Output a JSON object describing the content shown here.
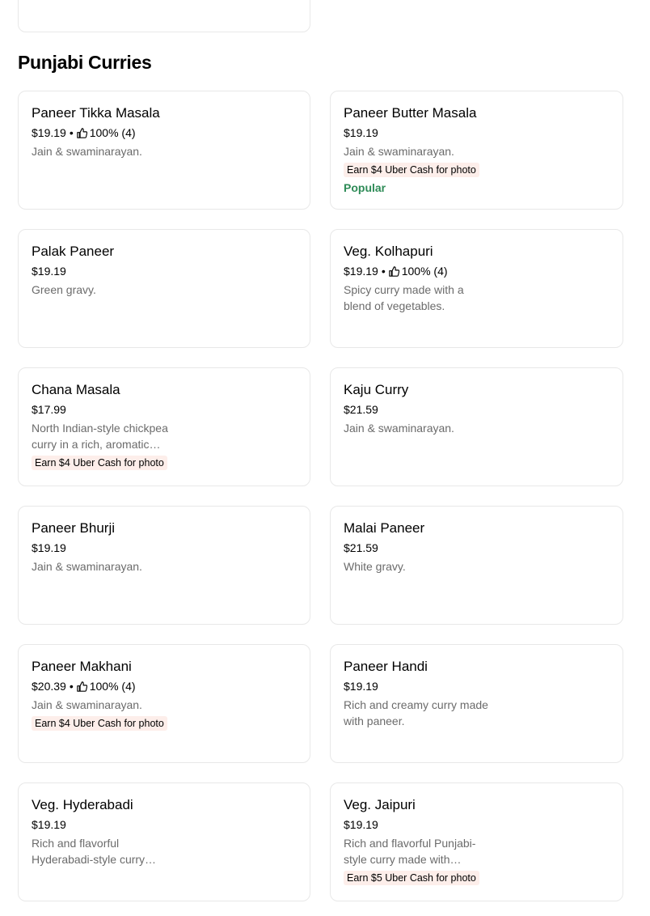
{
  "section": {
    "title": "Punjabi Curries"
  },
  "colors": {
    "popular": "#2e8b57",
    "promo_bg": "#fdeeea",
    "description": "#6b6b6b",
    "card_border": "#e8e8e8"
  },
  "items": [
    {
      "name": "Paneer Tikka Masala",
      "price": "$19.19",
      "rating": "100% (4)",
      "description": "Jain & swaminarayan.",
      "promo": "",
      "badge": ""
    },
    {
      "name": "Paneer Butter Masala",
      "price": "$19.19",
      "rating": "",
      "description": "Jain & swaminarayan.",
      "promo": "Earn $4 Uber Cash for photo",
      "badge": "Popular"
    },
    {
      "name": "Palak Paneer",
      "price": "$19.19",
      "rating": "",
      "description": "Green gravy.",
      "promo": "",
      "badge": ""
    },
    {
      "name": "Veg. Kolhapuri",
      "price": "$19.19",
      "rating": "100% (4)",
      "description": "Spicy curry made with a blend of vegetables.",
      "promo": "",
      "badge": ""
    },
    {
      "name": "Chana Masala",
      "price": "$17.99",
      "rating": "",
      "description": "North Indian-style chickpea curry in a rich, aromatic…",
      "promo": "Earn $4 Uber Cash for photo",
      "badge": ""
    },
    {
      "name": "Kaju Curry",
      "price": "$21.59",
      "rating": "",
      "description": "Jain & swaminarayan.",
      "promo": "",
      "badge": ""
    },
    {
      "name": "Paneer Bhurji",
      "price": "$19.19",
      "rating": "",
      "description": "Jain & swaminarayan.",
      "promo": "",
      "badge": ""
    },
    {
      "name": "Malai Paneer",
      "price": "$21.59",
      "rating": "",
      "description": "White gravy.",
      "promo": "",
      "badge": ""
    },
    {
      "name": "Paneer Makhani",
      "price": "$20.39",
      "rating": "100% (4)",
      "description": "Jain & swaminarayan.",
      "promo": "Earn $4 Uber Cash for photo",
      "badge": ""
    },
    {
      "name": "Paneer Handi",
      "price": "$19.19",
      "rating": "",
      "description": "Rich and creamy curry made with paneer.",
      "promo": "",
      "badge": ""
    },
    {
      "name": "Veg. Hyderabadi",
      "price": "$19.19",
      "rating": "",
      "description": "Rich and flavorful Hyderabadi-style curry…",
      "promo": "",
      "badge": ""
    },
    {
      "name": "Veg. Jaipuri",
      "price": "$19.19",
      "rating": "",
      "description": "Rich and flavorful Punjabi-style curry made with…",
      "promo": "Earn $5 Uber Cash for photo",
      "badge": ""
    }
  ]
}
